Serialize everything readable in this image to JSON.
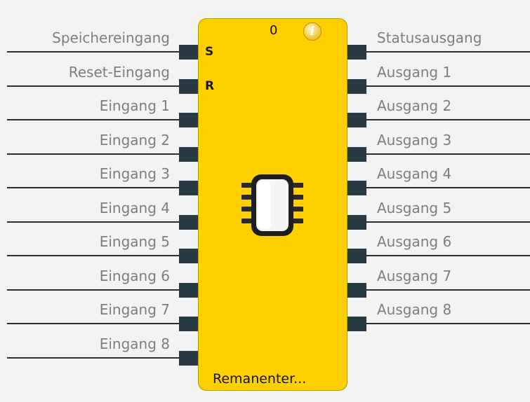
{
  "block": {
    "title": "Remanenter...",
    "counter": "0",
    "set_label": "S",
    "reset_label": "R",
    "icon": "chip-icon",
    "info_icon": "info-icon",
    "colors": {
      "body": "#ffd000",
      "connector": "#2a3a45",
      "label": "#7e7e7e"
    }
  },
  "inputs": [
    "Speichereingang",
    "Reset-Eingang",
    "Eingang 1",
    "Eingang 2",
    "Eingang 3",
    "Eingang 4",
    "Eingang 5",
    "Eingang 6",
    "Eingang 7",
    "Eingang 8"
  ],
  "outputs": [
    "Statusausgang",
    "Ausgang 1",
    "Ausgang 2",
    "Ausgang 3",
    "Ausgang 4",
    "Ausgang 5",
    "Ausgang 6",
    "Ausgang 7",
    "Ausgang 8"
  ]
}
